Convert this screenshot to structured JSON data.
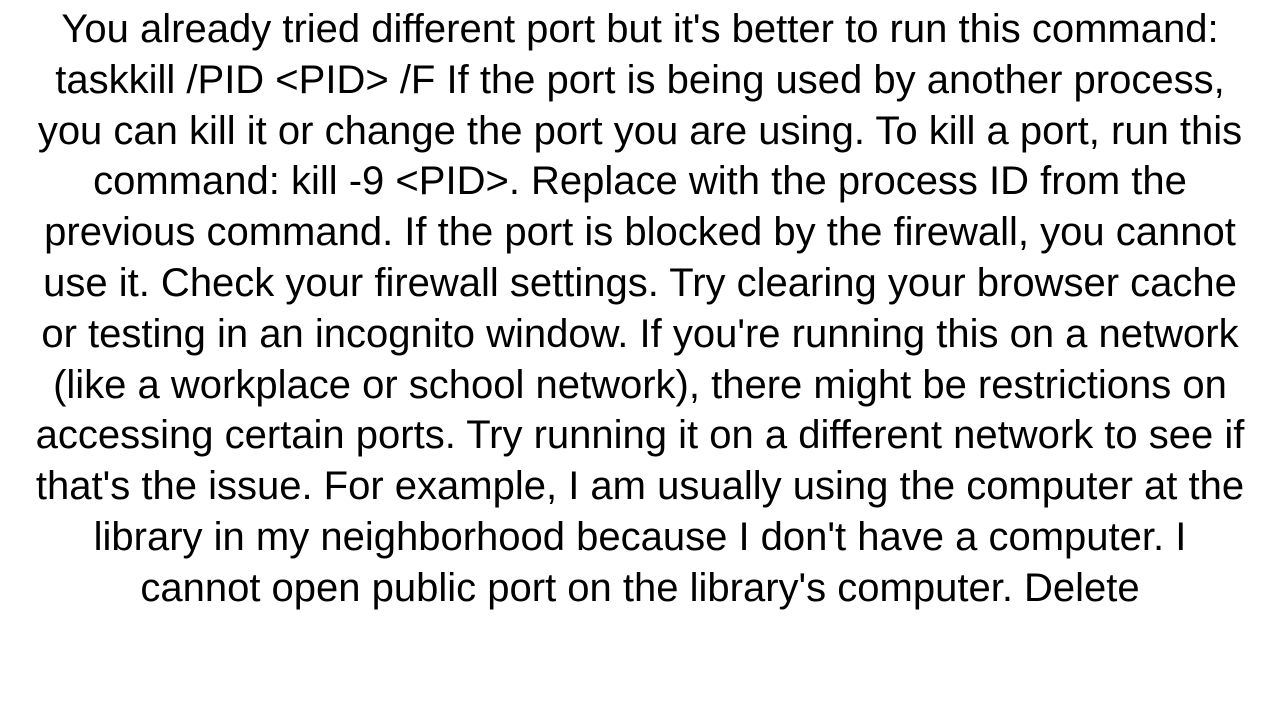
{
  "paragraph": "You already tried different port but it's better to run this command: taskkill /PID <PID> /F If the port is being used by another process, you can kill it or change the port you are using. To kill a port, run this command: kill -9 <PID>. Replace  with the process ID from the previous command.  If the port is blocked by the firewall, you cannot use it.  Check your firewall settings.  Try clearing your browser cache or testing in an incognito window.  If you're running this on a network (like a workplace or school network), there might be restrictions on accessing certain ports. Try running it on a different network to see if that's the issue. For example, I am usually using the computer at the library in my neighborhood because I don't have a computer. I cannot open public port on the library's computer.  Delete"
}
